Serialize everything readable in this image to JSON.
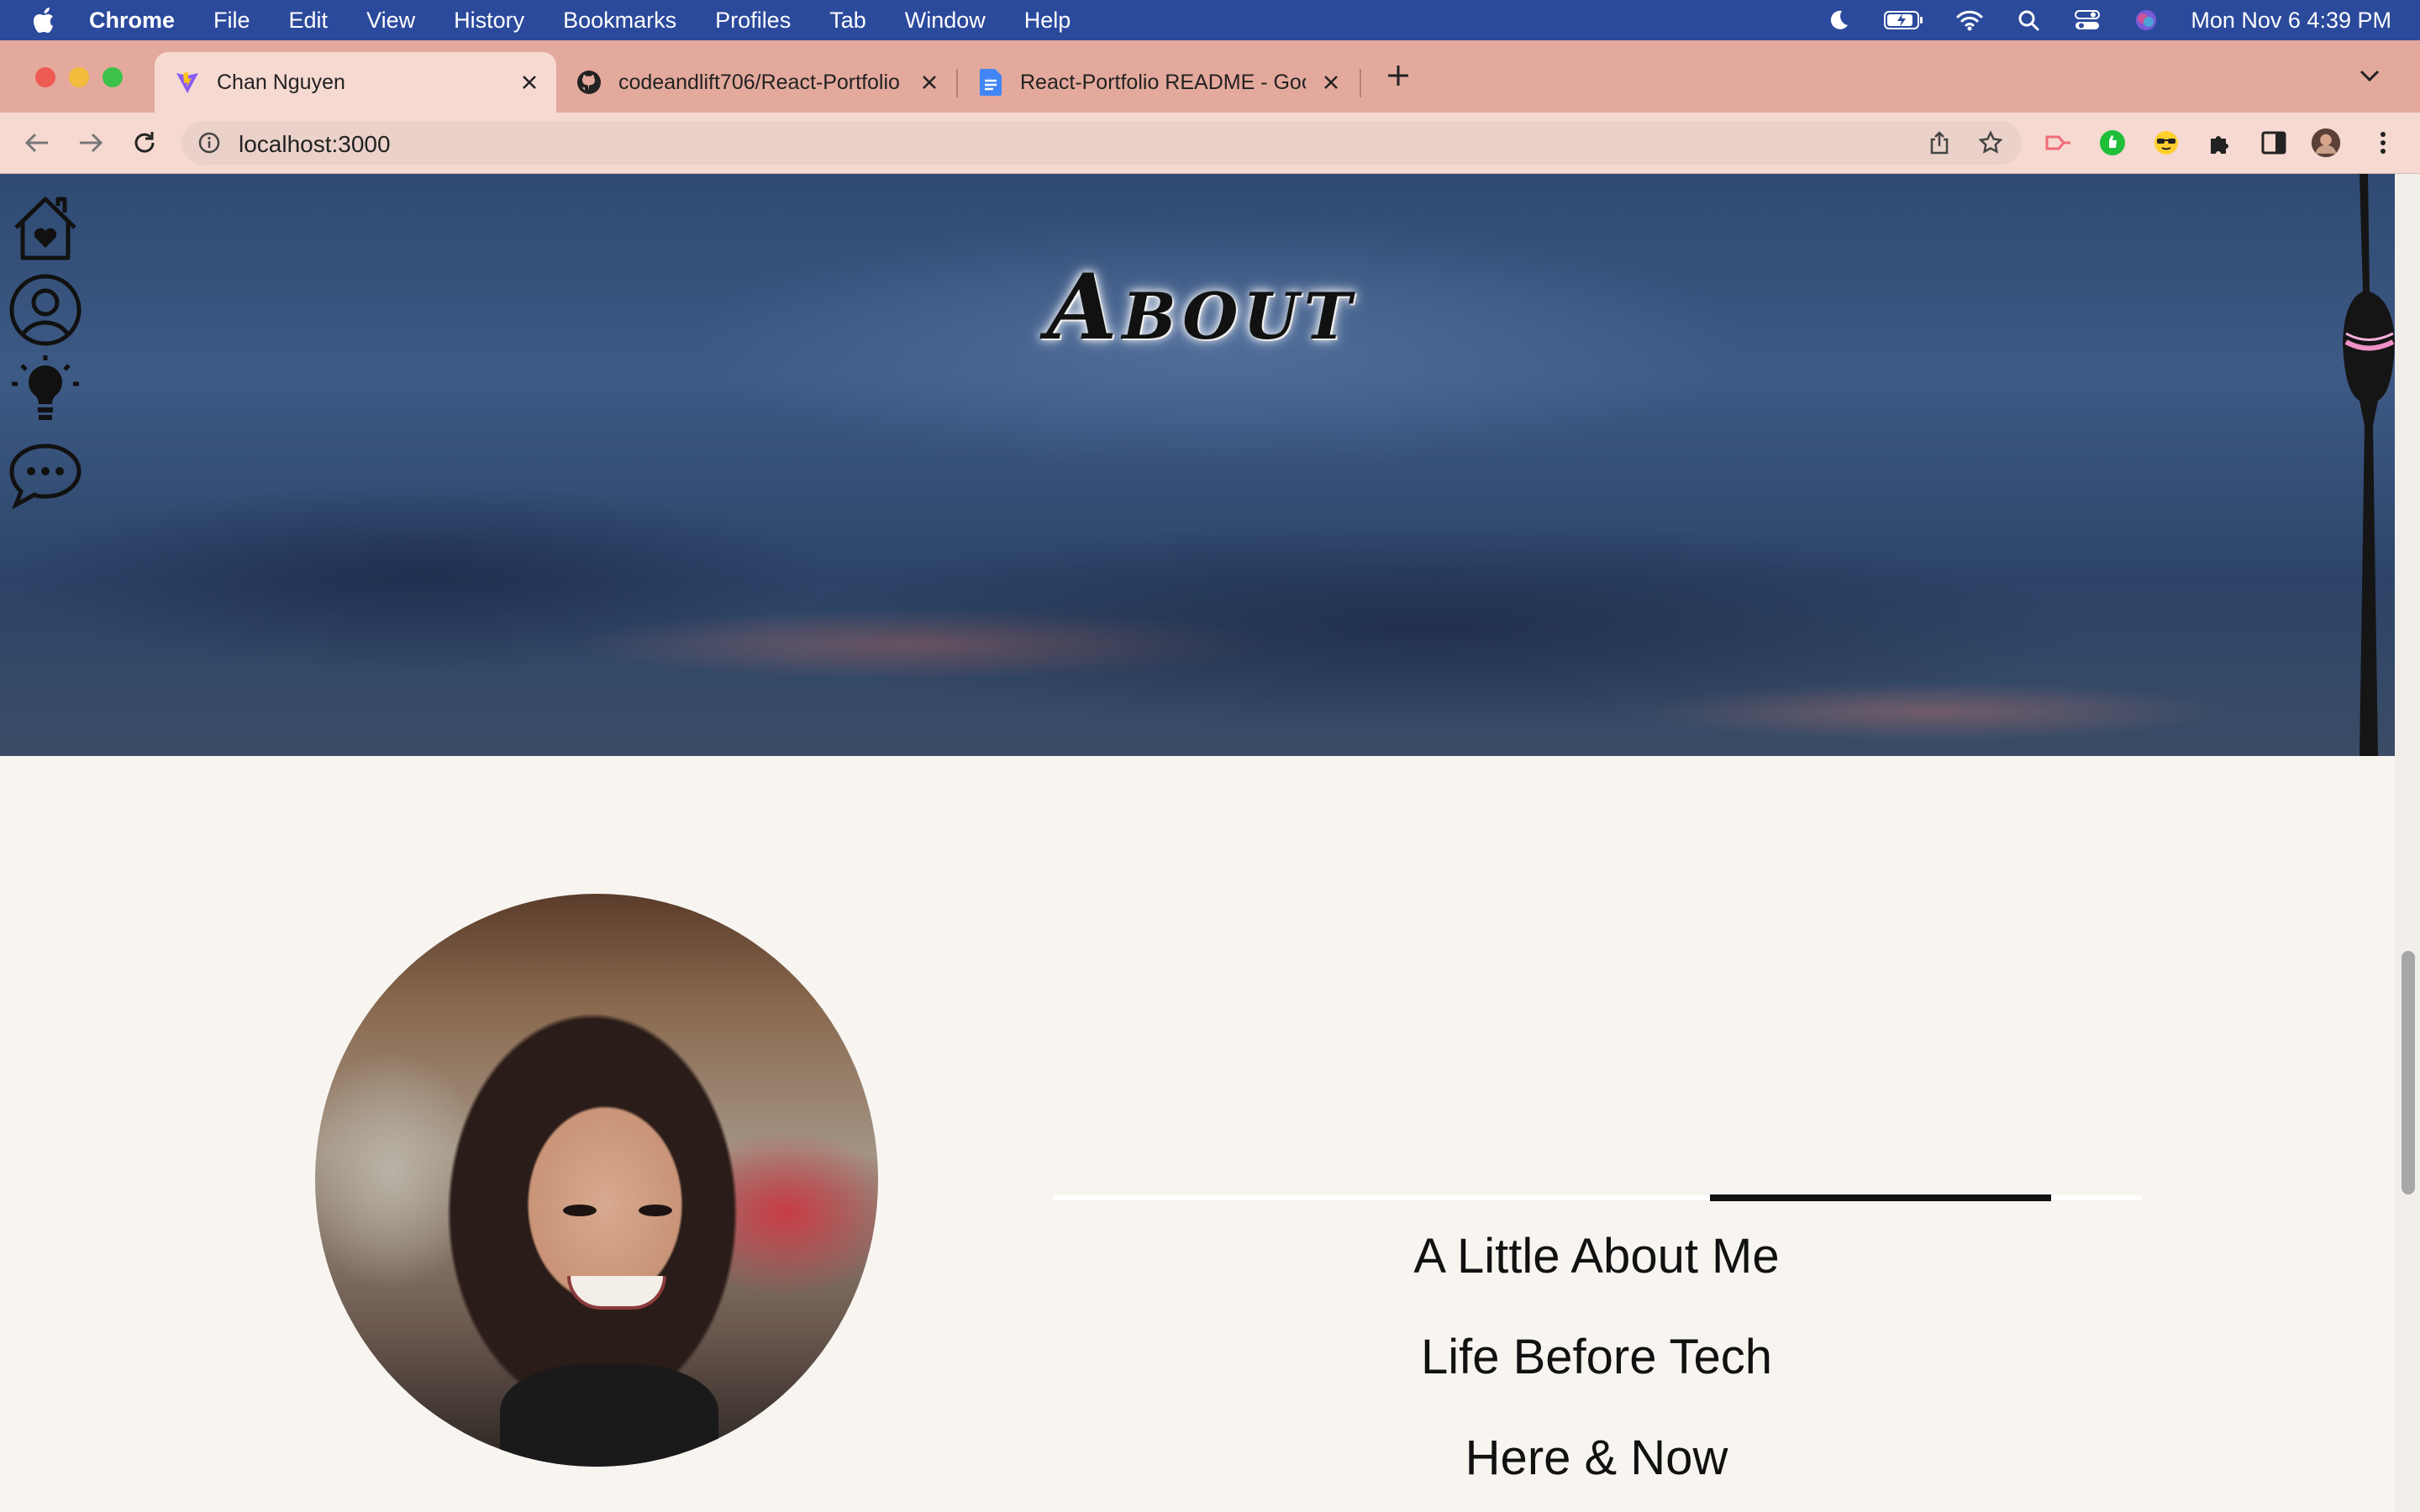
{
  "menubar": {
    "app": "Chrome",
    "items": [
      "File",
      "Edit",
      "View",
      "History",
      "Bookmarks",
      "Profiles",
      "Tab",
      "Window",
      "Help"
    ],
    "clock": "Mon Nov 6  4:39 PM"
  },
  "tabs": [
    {
      "title": "Chan Nguyen",
      "icon": "vite-icon",
      "active": true
    },
    {
      "title": "codeandlift706/React-Portfolio",
      "icon": "github-icon",
      "active": false
    },
    {
      "title": "React-Portfolio README - Goo",
      "icon": "google-docs-icon",
      "active": false
    }
  ],
  "toolbar": {
    "url": "localhost:3000"
  },
  "page": {
    "hero_title": "About",
    "side_nav": [
      "home-heart-icon",
      "user-profile-icon",
      "lightbulb-icon",
      "chat-bubble-icon"
    ],
    "about_links": [
      "A Little About Me",
      "Life Before Tech",
      "Here & Now"
    ]
  },
  "colors": {
    "menubar": "#2c4a9c",
    "tabstrip": "#e3a99c",
    "toolbar": "#f6d9d1",
    "page_bg": "#f8f5f1"
  }
}
